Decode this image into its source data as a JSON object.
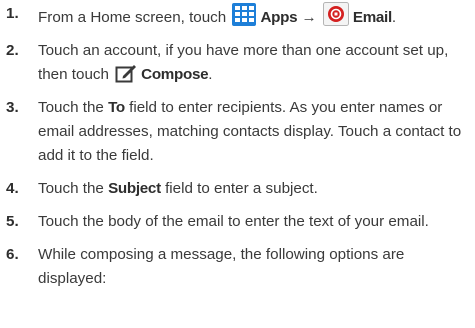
{
  "steps": [
    {
      "num": "1.",
      "parts": [
        {
          "t": "From a Home screen, touch "
        },
        {
          "icon": "apps-grid-icon"
        },
        {
          "b": "Apps"
        },
        {
          "t": " → "
        },
        {
          "icon": "email-app-icon"
        },
        {
          "b": "Email"
        },
        {
          "t": "."
        }
      ]
    },
    {
      "num": "2.",
      "parts": [
        {
          "t": "Touch an account, if you have more than one account set up, then touch "
        },
        {
          "icon": "compose-icon"
        },
        {
          "b": "Compose"
        },
        {
          "t": "."
        }
      ]
    },
    {
      "num": "3.",
      "parts": [
        {
          "t": "Touch the "
        },
        {
          "b": "To"
        },
        {
          "t": " field to enter recipients. As you enter names or email addresses, matching contacts display. Touch a contact to add it to the field."
        }
      ]
    },
    {
      "num": "4.",
      "parts": [
        {
          "t": "Touch the "
        },
        {
          "b": "Subject"
        },
        {
          "t": " field to enter a subject."
        }
      ]
    },
    {
      "num": "5.",
      "parts": [
        {
          "t": "Touch the body of the email to enter the text of your email."
        }
      ]
    },
    {
      "num": "6.",
      "parts": [
        {
          "t": "While composing a message, the following options are displayed:"
        }
      ]
    }
  ],
  "colors": {
    "apps_icon": "#1e7fd8",
    "email_icon": "#d42020",
    "text": "#3a3a3a"
  }
}
